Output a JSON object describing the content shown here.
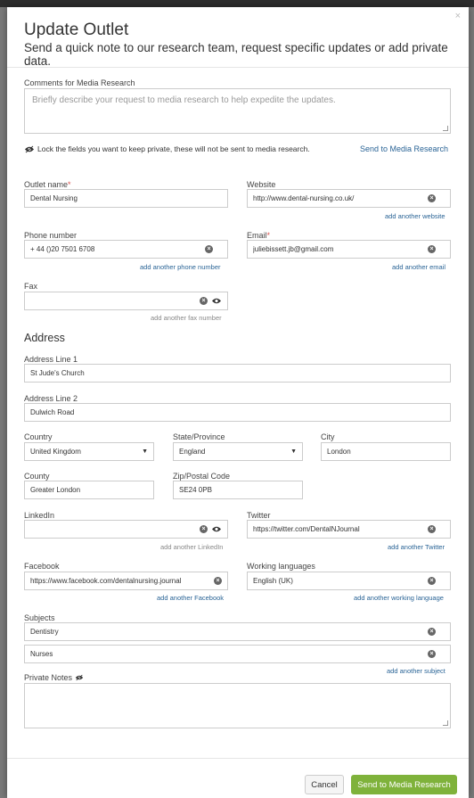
{
  "modal": {
    "title": "Update Outlet",
    "subtitle": "Send a quick note to our research team, request specific updates or add private data.",
    "close": "×"
  },
  "comments": {
    "label": "Comments for Media Research",
    "placeholder": "Briefly describe your request to media research to help expedite the updates."
  },
  "privacy": {
    "text": "Lock the fields you want to keep private, these will not be sent to media research.",
    "send_link": "Send to Media Research"
  },
  "fields": {
    "outlet_name": {
      "label": "Outlet name",
      "required": "*",
      "value": "Dental Nursing"
    },
    "website": {
      "label": "Website",
      "value": "http://www.dental-nursing.co.uk/",
      "add": "add another website"
    },
    "phone": {
      "label": "Phone number",
      "value": "+ 44  ()20 7501 6708",
      "add": "add another phone number"
    },
    "email": {
      "label": "Email",
      "required": "*",
      "value": "juliebissett.jb@gmail.com",
      "add": "add another email"
    },
    "fax": {
      "label": "Fax",
      "value": "",
      "add": "add another fax number"
    },
    "linkedin": {
      "label": "LinkedIn",
      "value": "",
      "add": "add another LinkedIn"
    },
    "twitter": {
      "label": "Twitter",
      "value": "https://twitter.com/DentalNJournal",
      "add": "add another Twitter"
    },
    "facebook": {
      "label": "Facebook",
      "value": "https://www.facebook.com/dentalnursing.journal",
      "add": "add another Facebook"
    },
    "languages": {
      "label": "Working languages",
      "value": "English (UK)",
      "add": "add another working language"
    }
  },
  "address": {
    "title": "Address",
    "line1": {
      "label": "Address Line 1",
      "value": "St Jude's Church"
    },
    "line2": {
      "label": "Address Line 2",
      "value": "Dulwich Road"
    },
    "country": {
      "label": "Country",
      "value": "United Kingdom"
    },
    "state": {
      "label": "State/Province",
      "value": "England"
    },
    "city": {
      "label": "City",
      "value": "London"
    },
    "county": {
      "label": "County",
      "value": "Greater London"
    },
    "zip": {
      "label": "Zip/Postal Code",
      "value": "SE24 0PB"
    }
  },
  "subjects": {
    "label": "Subjects",
    "items": [
      "Dentistry",
      "Nurses"
    ],
    "add": "add another subject"
  },
  "private_notes": {
    "label": "Private Notes"
  },
  "footer": {
    "cancel": "Cancel",
    "send": "Send to Media Research"
  },
  "colors": {
    "accent_link": "#2a6496",
    "send_button": "#7fb23b",
    "required": "#d9534f"
  }
}
